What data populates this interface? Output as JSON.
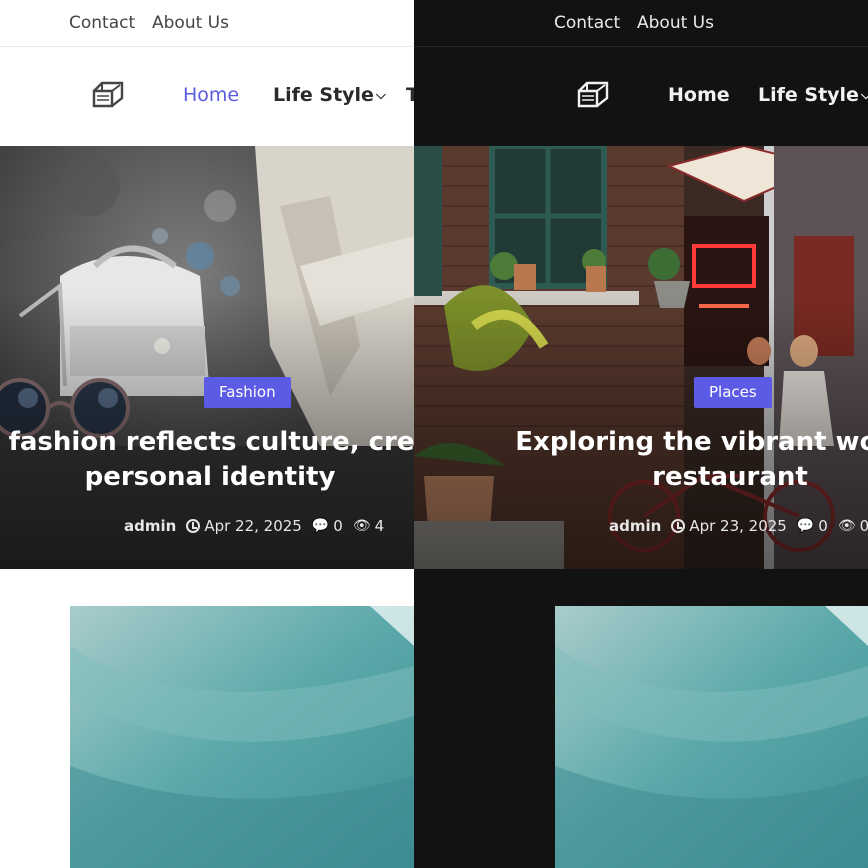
{
  "topbar": {
    "contact_label": "Contact",
    "about_label": "About Us"
  },
  "nav": {
    "home_label": "Home",
    "lifestyle_label": "Life Style",
    "cut_label": "T"
  },
  "colors": {
    "accent": "#5b5be6",
    "dark_bg": "#121212",
    "light_bg": "#ffffff"
  },
  "icons": {
    "logo": "site-logo-icon",
    "chevron": "chevron-down-icon",
    "clock": "clock-icon",
    "comment": "comment-icon",
    "eye": "eye-icon"
  },
  "light_post": {
    "category": "Fashion",
    "title_line1": "w fashion reflects culture, creat",
    "title_line2": "personal identity",
    "author": "admin",
    "date": "Apr 22, 2025",
    "comments": "0",
    "views": "4"
  },
  "dark_post": {
    "category": "Places",
    "title_line1": "Exploring the vibrant world o",
    "title_line2": "restaurant",
    "author": "admin",
    "date": "Apr 23, 2025",
    "comments": "0",
    "views": "0"
  }
}
